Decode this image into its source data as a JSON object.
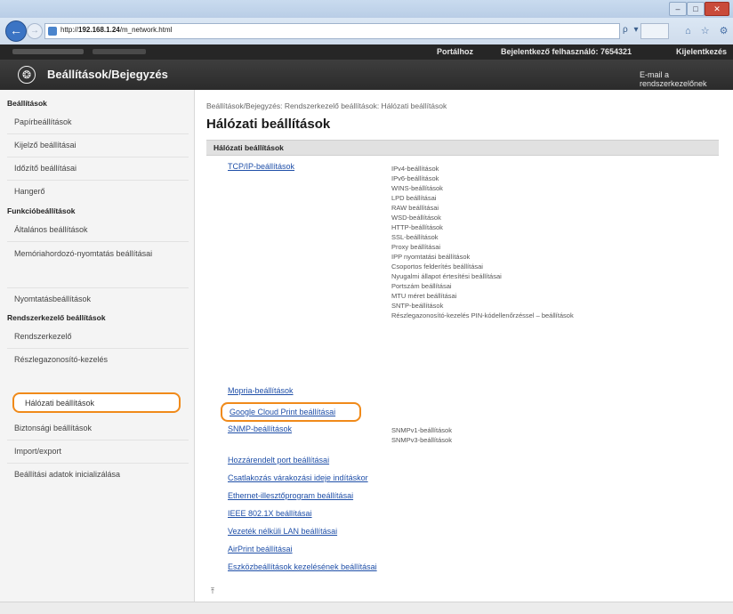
{
  "browser": {
    "url_prefix": "http://",
    "url_host": "192.168.1.24",
    "url_path": "/m_network.html",
    "address_controls": "ρ ▾ ≡ ↻",
    "nav_icons": "⌂ ☆ ⚙",
    "window_controls": {
      "min": "–",
      "max": "□",
      "close": "✕"
    }
  },
  "header": {
    "portal_label": "Portálhoz",
    "login_label": "Bejelentkező felhasználó:  7654321",
    "logout_label": "Kijelentkezés",
    "app_title": "Beállítások/Bejegyzés",
    "email_admin_label": "E-mail a rendszerkezelőnek"
  },
  "sidebar": {
    "settings_heading": "Beállítások",
    "settings_items": [
      "Papírbeállítások",
      "Kijelző beállításai",
      "Időzítő beállításai",
      "Hangerő"
    ],
    "function_heading": "Funkcióbeállítások",
    "function_items": [
      "Általános beállítások",
      "Memóriahordozó-nyomtatás beállításai",
      "Nyomtatásbeállítások"
    ],
    "admin_heading": "Rendszerkezelő beállítások",
    "admin_items": [
      "Rendszerkezelő",
      "Részlegazonosító-kezelés",
      "Hálózati beállítások",
      "Biztonsági beállítások",
      "Import/export",
      "Beállítási adatok inicializálása"
    ]
  },
  "main": {
    "breadcrumb": "Beállítások/Bejegyzés: Rendszerkezelő beállítások: Hálózati beállítások",
    "page_title": "Hálózati beállítások",
    "section_title": "Hálózati beállítások",
    "tcpip_link": "TCP/IP-beállítások",
    "tcpip_subitems": [
      "IPv4-beállítások",
      "IPv6-beállítások",
      "WINS-beállítások",
      "LPD beállításai",
      "RAW beállításai",
      "WSD-beállítások",
      "HTTP-beállítások",
      "SSL-beállítások",
      "Proxy beállításai",
      "IPP nyomtatási beállítások",
      "Csoportos felderítés beállításai",
      "Nyugalmi állapot értesítési beállításai",
      "Portszám beállításai",
      "MTU méret beállításai",
      "SNTP-beállítások",
      "Részlegazonosító-kezelés PIN-kódellenőrzéssel – beállítások"
    ],
    "mopria_link": "Mopria-beállítások",
    "google_link": "Google Cloud Print beállításai",
    "snmp_link": "SNMP-beállítások",
    "snmp_subitems": [
      "SNMPv1-beállítások",
      "SNMPv3-beállítások"
    ],
    "more_links": [
      "Hozzárendelt port beállításai",
      "Csatlakozás várakozási ideje indításkor",
      "Ethernet-illesztőprogram beállításai",
      "IEEE 802.1X beállításai",
      "Vezeték nélküli LAN beállításai",
      "AirPrint beállításai",
      "Eszközbeállítások kezelésének beállításai"
    ],
    "top_icon": "⤒"
  }
}
